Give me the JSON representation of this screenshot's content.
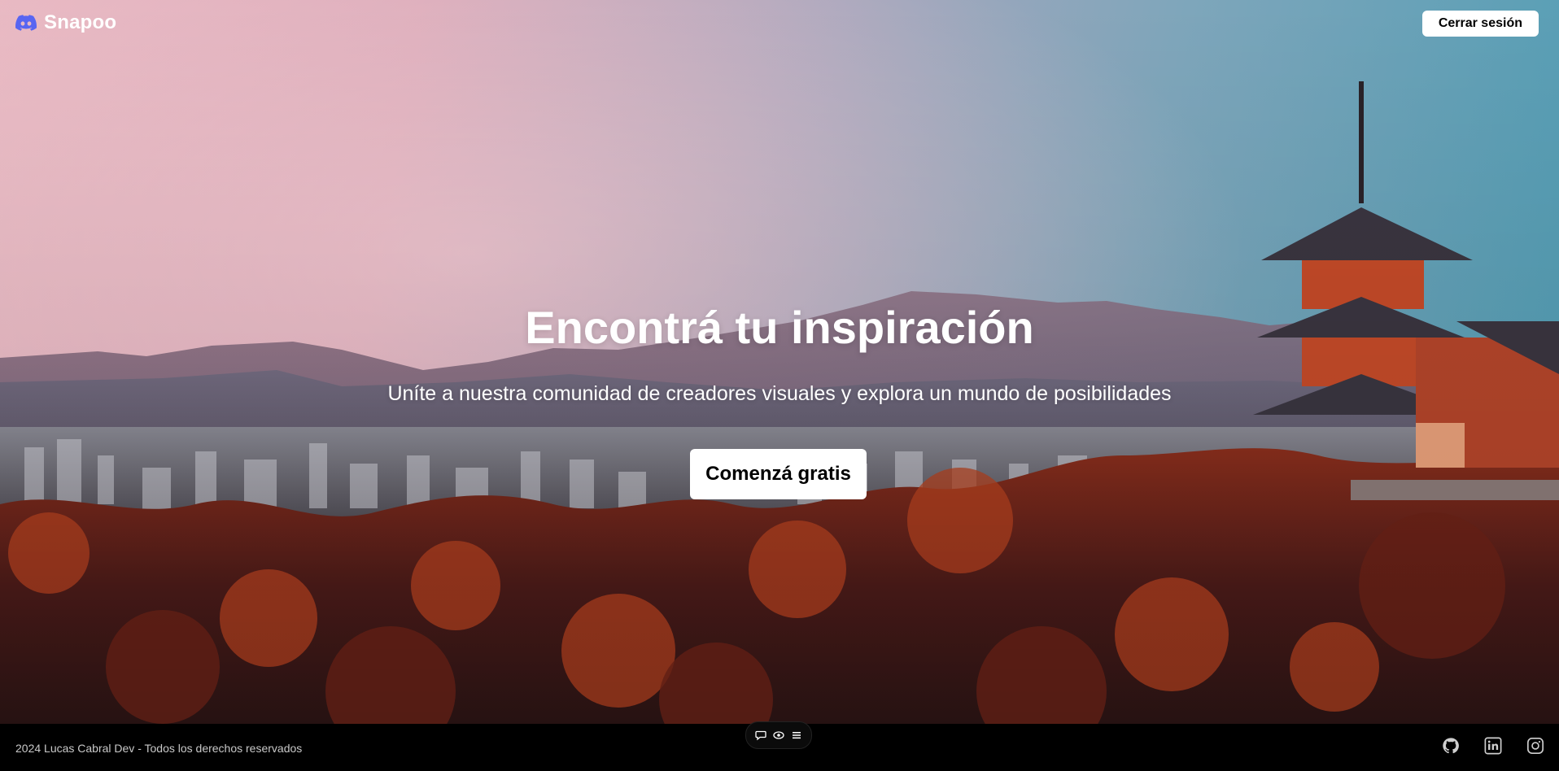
{
  "brand": {
    "name": "Snapoo",
    "icon": "discord-icon"
  },
  "header": {
    "logout_label": "Cerrar sesión"
  },
  "hero": {
    "title": "Encontrá tu inspiración",
    "subtitle": "Uníte a nuestra comunidad de creadores visuales y explora un mundo de posibilidades",
    "cta_label": "Comenzá gratis",
    "background": "kyoto-pagoda-sunset-photo"
  },
  "footer": {
    "copyright": "2024 Lucas Cabral Dev - Todos los derechos reservados",
    "toolbar_icons": [
      "comment-icon",
      "eye-icon",
      "menu-icon"
    ],
    "social_icons": [
      "github-icon",
      "linkedin-icon",
      "instagram-icon"
    ]
  },
  "colors": {
    "accent": "#5865f2",
    "button_bg": "#ffffff",
    "footer_bg": "#000000"
  }
}
